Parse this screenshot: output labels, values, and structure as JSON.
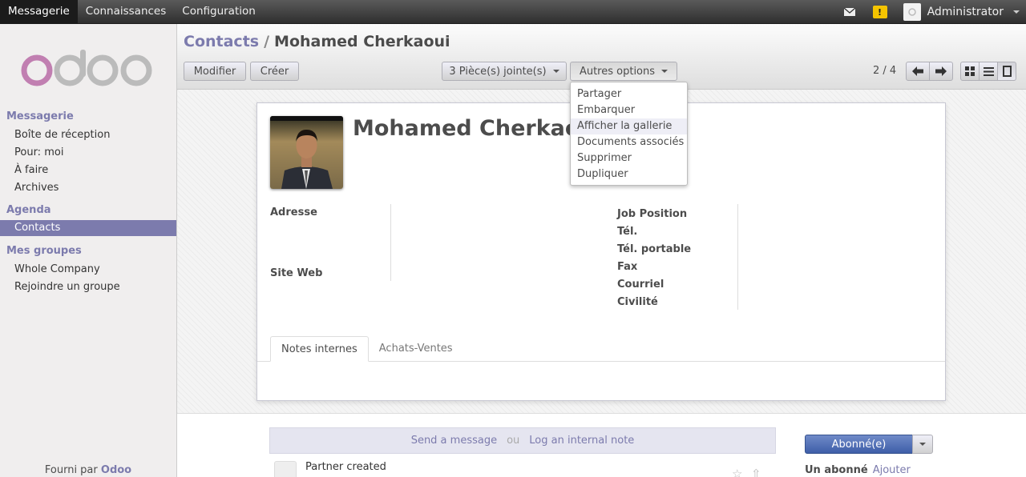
{
  "topbar": {
    "menus": [
      "Messagerie",
      "Connaissances",
      "Configuration"
    ],
    "active_menu": "Messagerie",
    "user_name": "Administrator",
    "warning_badge": "!"
  },
  "logo_text": "odoo",
  "sidebar": {
    "sections": [
      {
        "title": "Messagerie",
        "items": [
          "Boîte de réception",
          "Pour: moi",
          "À faire",
          "Archives"
        ]
      },
      {
        "title": "Agenda",
        "items": [
          "Contacts"
        ]
      },
      {
        "title": "Mes groupes",
        "items": [
          "Whole Company",
          "Rejoindre un groupe"
        ]
      }
    ],
    "active_item": "Contacts",
    "powered_prefix": "Fourni par",
    "powered_brand": "Odoo"
  },
  "breadcrumb": {
    "parent": "Contacts",
    "separator": "/",
    "current": "Mohamed Cherkaoui"
  },
  "toolbar": {
    "edit_label": "Modifier",
    "create_label": "Créer",
    "attachments_label": "3 Pièce(s) jointe(s)",
    "more_label": "Autres options"
  },
  "more_menu": {
    "items": [
      "Partager",
      "Embarquer",
      "Afficher la gallerie",
      "Documents associés",
      "Supprimer",
      "Dupliquer"
    ],
    "highlighted": "Afficher la gallerie"
  },
  "pager": {
    "text": "2 / 4"
  },
  "view_switcher": [
    "kanban-view",
    "list-view",
    "form-view"
  ],
  "active_view": "form-view",
  "contact": {
    "name": "Mohamed Cherkaoui",
    "left_fields": [
      "Adresse",
      "Site Web"
    ],
    "right_fields": [
      "Job Position",
      "Tél.",
      "Tél. portable",
      "Fax",
      "Courriel",
      "Civilité"
    ]
  },
  "tabs": [
    "Notes internes",
    "Achats-Ventes"
  ],
  "active_tab": "Notes internes",
  "chatter": {
    "send_message": "Send a message",
    "or": "ou",
    "log_note": "Log an internal note",
    "follow_label": "Abonné(e)",
    "followers_label": "Un abonné",
    "add_follower": "Ajouter",
    "message_text": "Partner created"
  },
  "colors": {
    "accent": "#7c7bad",
    "follow_button": "#4a68b0",
    "topbar": "#3a3a3a"
  }
}
